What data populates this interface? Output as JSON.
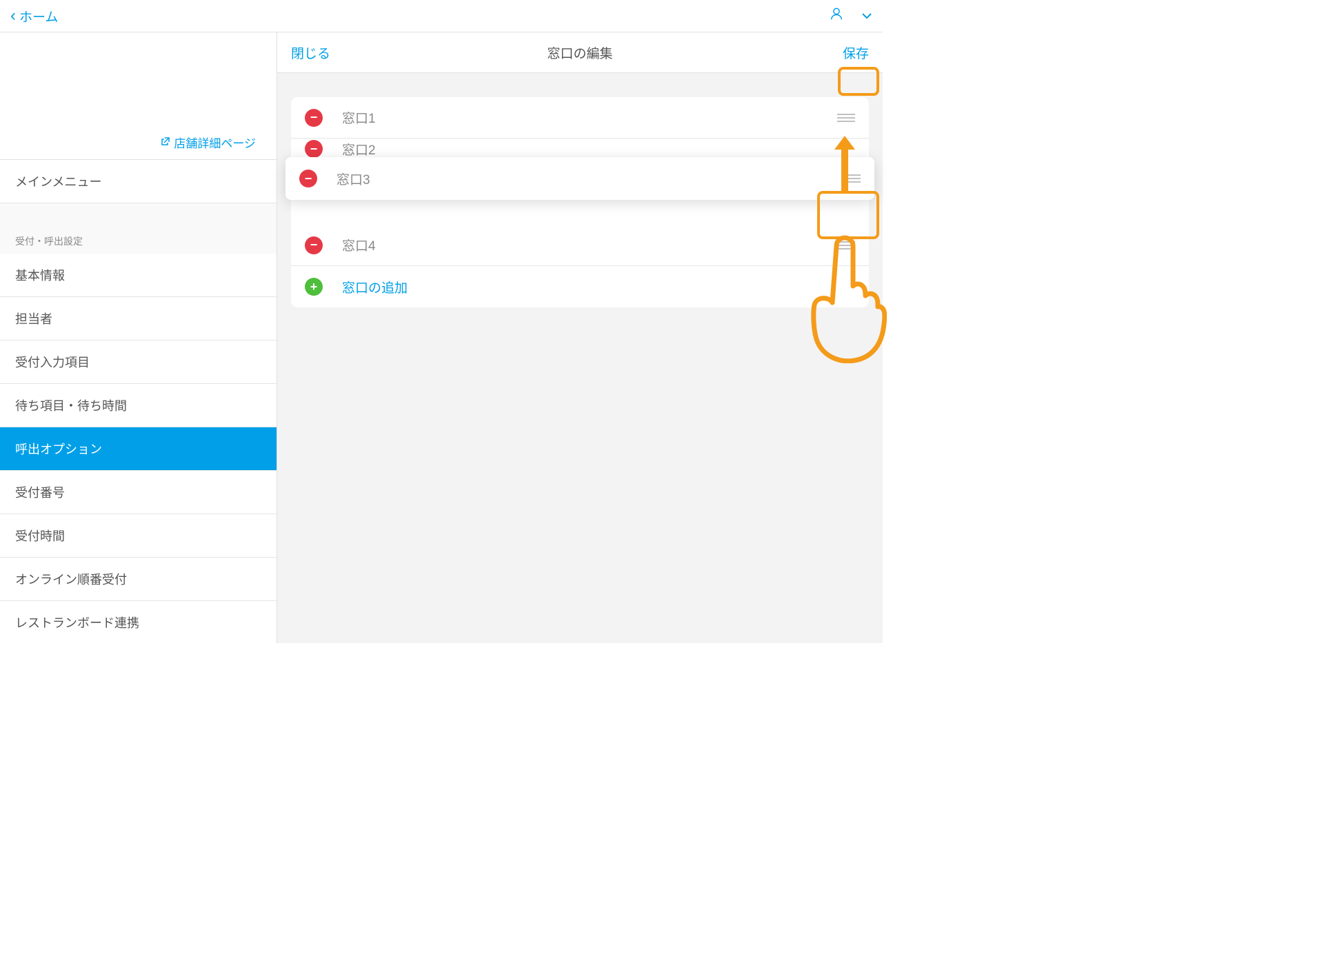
{
  "nav": {
    "back_label": "ホーム"
  },
  "sidebar": {
    "store_link": "店舗詳細ページ",
    "main_menu": "メインメニュー",
    "section_header": "受付・呼出設定",
    "items": [
      {
        "label": "基本情報"
      },
      {
        "label": "担当者"
      },
      {
        "label": "受付入力項目"
      },
      {
        "label": "待ち項目・待ち時間"
      },
      {
        "label": "呼出オプション"
      },
      {
        "label": "受付番号"
      },
      {
        "label": "受付時間"
      },
      {
        "label": "オンライン順番受付"
      },
      {
        "label": "レストランボード連携"
      }
    ]
  },
  "header": {
    "close": "閉じる",
    "title": "窓口の編集",
    "save": "保存"
  },
  "rows": {
    "r1": "窓口1",
    "r2": "窓口2",
    "r3": "窓口3",
    "r4": "窓口4",
    "add": "窓口の追加"
  }
}
